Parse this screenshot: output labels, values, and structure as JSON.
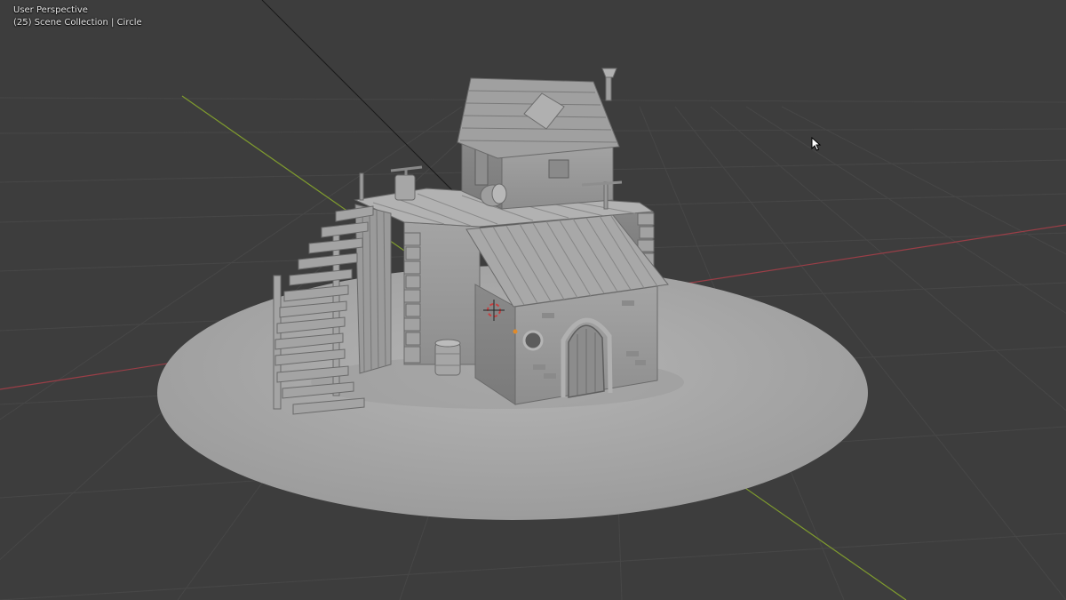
{
  "viewport": {
    "view_mode": "User Perspective",
    "scene_info": "(25) Scene Collection | Circle",
    "background_color": "#3d3d3d",
    "grid_color": "#4a4a4a",
    "x_axis_color": "#9a3e47",
    "y_axis_color": "#7f9b2e",
    "ground_disc_color": "#a8a8a8",
    "model_color": "#9e9e9e"
  },
  "scene": {
    "objects": [
      "ground-disc-circle",
      "house-model",
      "staircase",
      "barrel",
      "cabin",
      "3d-cursor"
    ]
  },
  "mouse_cursor": "arrow-pointer-icon"
}
